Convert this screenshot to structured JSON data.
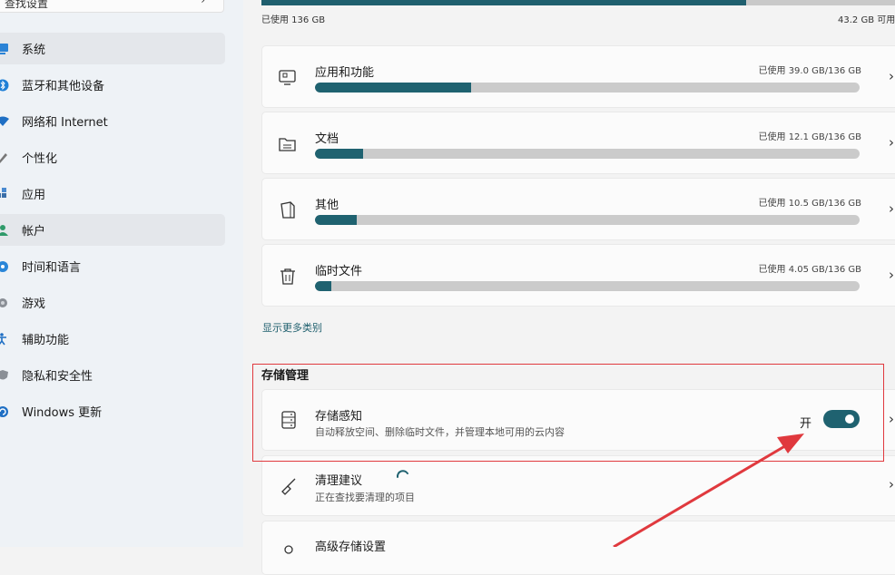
{
  "sidebar": {
    "search_text": "查找设置",
    "items": [
      {
        "label": "系统",
        "icon": "system-icon",
        "selected": true
      },
      {
        "label": "蓝牙和其他设备",
        "icon": "bluetooth-icon",
        "selected": false
      },
      {
        "label": "网络和 Internet",
        "icon": "wifi-icon",
        "selected": false
      },
      {
        "label": "个性化",
        "icon": "pen-icon",
        "selected": false
      },
      {
        "label": "应用",
        "icon": "apps-icon",
        "selected": false
      },
      {
        "label": "帐户",
        "icon": "account-icon",
        "selected": true
      },
      {
        "label": "时间和语言",
        "icon": "globe-icon",
        "selected": false
      },
      {
        "label": "游戏",
        "icon": "gamepad-icon",
        "selected": false
      },
      {
        "label": "辅助功能",
        "icon": "accessibility-icon",
        "selected": false
      },
      {
        "label": "隐私和安全性",
        "icon": "shield-icon",
        "selected": false
      },
      {
        "label": "Windows 更新",
        "icon": "update-icon",
        "selected": false
      }
    ]
  },
  "storage": {
    "total_used": "已使用 136 GB",
    "available": "43.2 GB 可用",
    "used_fraction": 0.752,
    "categories": [
      {
        "name": "应用和功能",
        "used": "已使用 39.0 GB/136 GB",
        "fraction": 0.287,
        "icon": "apps-features-icon"
      },
      {
        "name": "文档",
        "used": "已使用 12.1 GB/136 GB",
        "fraction": 0.089,
        "icon": "folder-icon"
      },
      {
        "name": "其他",
        "used": "已使用 10.5 GB/136 GB",
        "fraction": 0.077,
        "icon": "other-file-icon"
      },
      {
        "name": "临时文件",
        "used": "已使用 4.05 GB/136 GB",
        "fraction": 0.03,
        "icon": "trash-icon"
      }
    ],
    "show_more": "显示更多类别"
  },
  "management": {
    "title": "存储管理",
    "storage_sense": {
      "title": "存储感知",
      "description": "自动释放空间、删除临时文件，并管理本地可用的云内容",
      "state": "开",
      "on": true
    },
    "cleanup": {
      "title": "清理建议",
      "description": "正在查找要清理的项目"
    },
    "advanced": {
      "title": "高级存储设置"
    }
  },
  "colors": {
    "accent": "#1f6270",
    "annotation": "#e0393e"
  }
}
